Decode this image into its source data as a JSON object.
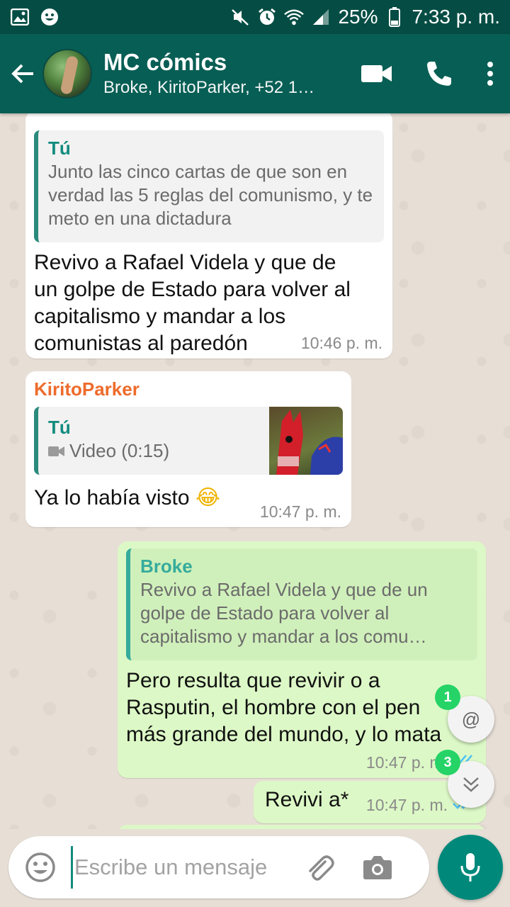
{
  "status_bar": {
    "battery": "25%",
    "time": "7:33 p. m."
  },
  "header": {
    "title": "MC cómics",
    "subtitle": "Broke, KiritoParker, +52 1…"
  },
  "messages": [
    {
      "quote_author": "Tú",
      "quote_text": "Junto las cinco cartas de que son en verdad las 5 reglas del comunismo, y te meto en una dictadura",
      "text": "Revivo a Rafael Videla y que de un golpe de Estado para volver al capitalismo y mandar a los comunistas al paredón",
      "time": "10:46 p. m."
    },
    {
      "sender": "KiritoParker",
      "quote_author": "Tú",
      "quote_text": "Video (0:15)",
      "text": "Ya lo había visto",
      "emoji": "😂",
      "time": "10:47 p. m."
    },
    {
      "quote_author": "Broke",
      "quote_text": "Revivo a Rafael Videla y que de un golpe de Estado para volver al capitalismo y mandar a los comu…",
      "text": "Pero resulta que revivir o a Rasputin, el hombre con el pen más grande del mundo, y lo mata",
      "time": "10:47 p. m."
    },
    {
      "text": "Revivi a*",
      "time": "10:47 p. m."
    }
  ],
  "floating": {
    "mention_badge": "1",
    "mention_symbol": "@",
    "unread_badge": "3"
  },
  "input": {
    "placeholder": "Escribe un mensaje"
  },
  "colors": {
    "header": "#075e54",
    "status_bar": "#054d44",
    "outgoing_bubble": "#dcf8c6",
    "accent": "#25d366",
    "mic_button": "#00897b"
  }
}
